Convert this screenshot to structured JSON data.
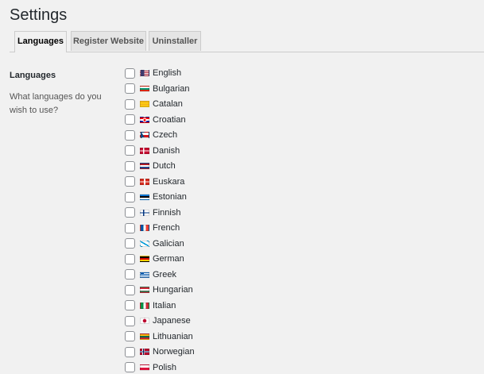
{
  "page": {
    "title": "Settings"
  },
  "tabs": [
    {
      "label": "Languages",
      "active": true
    },
    {
      "label": "Register Website",
      "active": false
    },
    {
      "label": "Uninstaller",
      "active": false
    }
  ],
  "section": {
    "title": "Languages",
    "description": "What languages do you wish to use?"
  },
  "languages": [
    {
      "label": "English",
      "flag": "us-flag-icon",
      "checked": false
    },
    {
      "label": "Bulgarian",
      "flag": "bg-flag-icon",
      "checked": false
    },
    {
      "label": "Catalan",
      "flag": "cat-flag-icon",
      "checked": false
    },
    {
      "label": "Croatian",
      "flag": "hr-flag-icon",
      "checked": false
    },
    {
      "label": "Czech",
      "flag": "cz-flag-icon",
      "checked": false
    },
    {
      "label": "Danish",
      "flag": "dk-flag-icon",
      "checked": false
    },
    {
      "label": "Dutch",
      "flag": "nl-flag-icon",
      "checked": false
    },
    {
      "label": "Euskara",
      "flag": "eu-flag-icon",
      "checked": false
    },
    {
      "label": "Estonian",
      "flag": "ee-flag-icon",
      "checked": false
    },
    {
      "label": "Finnish",
      "flag": "fi-flag-icon",
      "checked": false
    },
    {
      "label": "French",
      "flag": "fr-flag-icon",
      "checked": false
    },
    {
      "label": "Galician",
      "flag": "gl-flag-icon",
      "checked": false
    },
    {
      "label": "German",
      "flag": "de-flag-icon",
      "checked": false
    },
    {
      "label": "Greek",
      "flag": "gr-flag-icon",
      "checked": false
    },
    {
      "label": "Hungarian",
      "flag": "hu-flag-icon",
      "checked": false
    },
    {
      "label": "Italian",
      "flag": "it-flag-icon",
      "checked": false
    },
    {
      "label": "Japanese",
      "flag": "jp-flag-icon",
      "checked": false
    },
    {
      "label": "Lithuanian",
      "flag": "lt-flag-icon",
      "checked": false
    },
    {
      "label": "Norwegian",
      "flag": "no-flag-icon",
      "checked": false
    },
    {
      "label": "Polish",
      "flag": "pl-flag-icon",
      "checked": false
    }
  ]
}
